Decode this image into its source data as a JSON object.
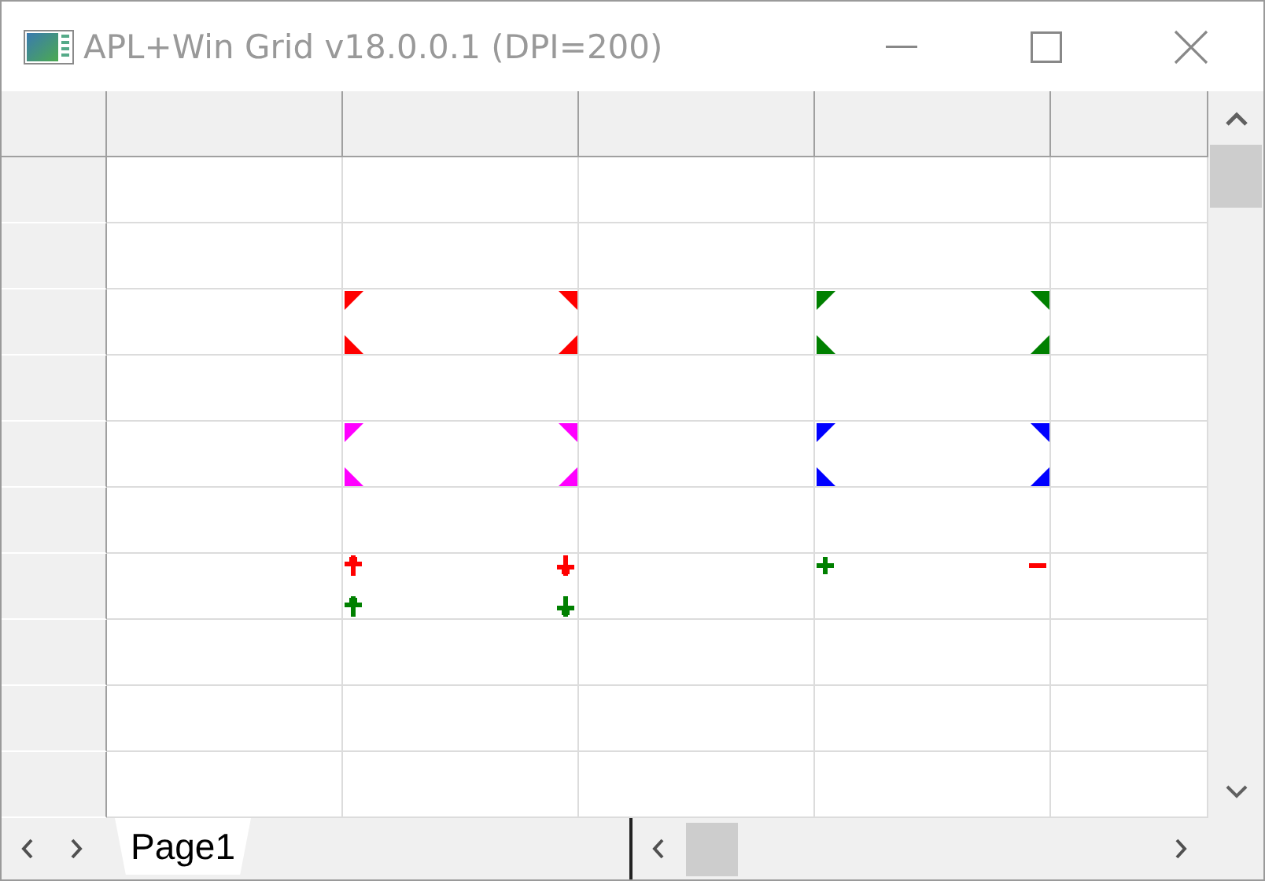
{
  "window": {
    "title": "APL+Win Grid v18.0.0.1 (DPI=200)"
  },
  "grid": {
    "rows": [
      {
        "kind": "empty"
      },
      {
        "kind": "empty"
      },
      {
        "kind": "marked",
        "cells": [
          {
            "kind": "none"
          },
          {
            "kind": "corners",
            "color": "#ff0000"
          },
          {
            "kind": "none"
          },
          {
            "kind": "corners",
            "color": "#008000"
          },
          {
            "kind": "none"
          }
        ]
      },
      {
        "kind": "empty"
      },
      {
        "kind": "marked",
        "cells": [
          {
            "kind": "none"
          },
          {
            "kind": "corners",
            "color": "#ff00ff"
          },
          {
            "kind": "none"
          },
          {
            "kind": "corners",
            "color": "#0000ff"
          },
          {
            "kind": "none"
          }
        ]
      },
      {
        "kind": "empty"
      },
      {
        "kind": "marked",
        "cells": [
          {
            "kind": "none"
          },
          {
            "kind": "signs",
            "marks": [
              {
                "kind": "up",
                "color": "#ff0000"
              },
              {
                "kind": "down",
                "color": "#ff0000"
              },
              {
                "kind": "up",
                "color": "#008000"
              },
              {
                "kind": "down",
                "color": "#008000"
              }
            ]
          },
          {
            "kind": "none"
          },
          {
            "kind": "signs",
            "marks": [
              {
                "kind": "plus",
                "color": "#008000"
              },
              {
                "kind": "minus",
                "color": "#ff0000"
              }
            ]
          },
          {
            "kind": "none"
          }
        ]
      },
      {
        "kind": "empty"
      },
      {
        "kind": "empty"
      },
      {
        "kind": "empty"
      }
    ]
  },
  "sheet_tabs": [
    {
      "label": "Page1",
      "selected": true
    }
  ]
}
